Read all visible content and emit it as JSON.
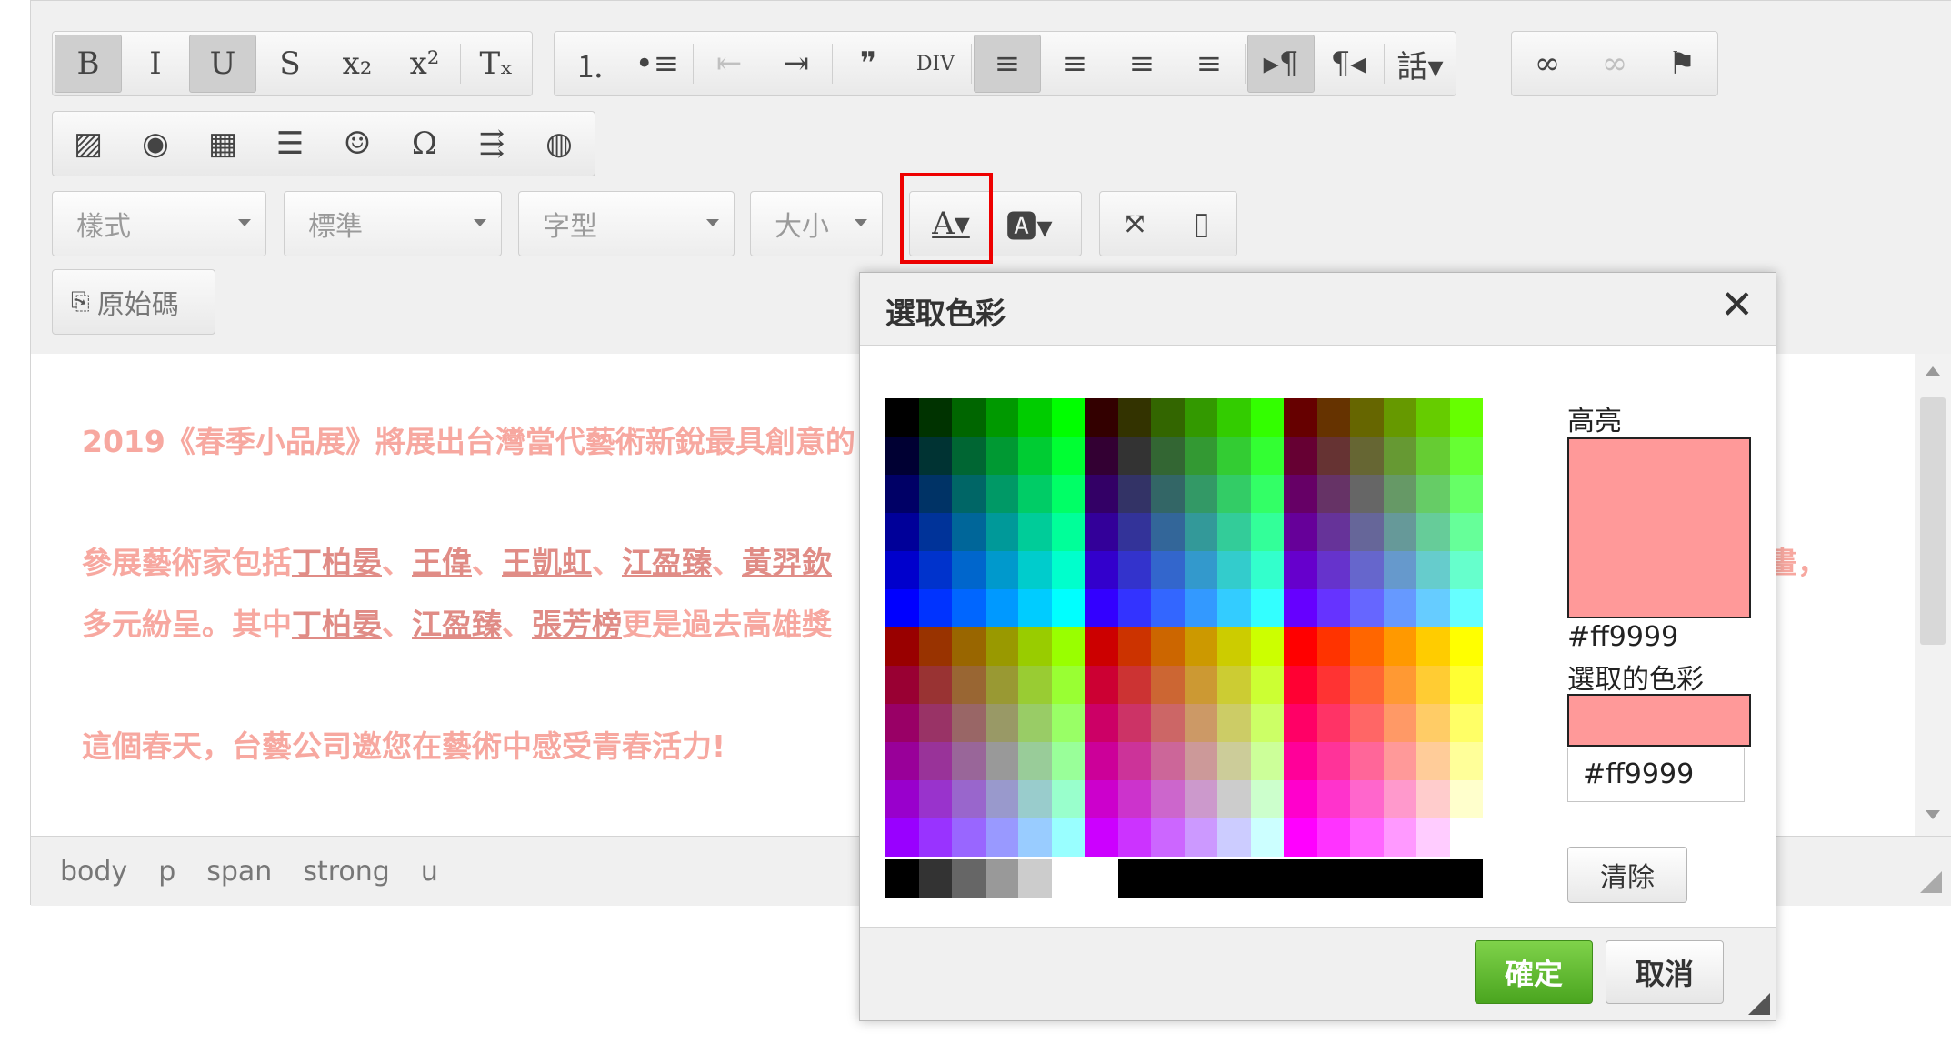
{
  "toolbar": {
    "row1_group1": [
      {
        "name": "bold-button",
        "label": "B",
        "on": true
      },
      {
        "name": "italic-button",
        "label": "I",
        "on": false
      },
      {
        "name": "underline-button",
        "label": "U",
        "on": true
      },
      {
        "name": "strike-button",
        "label": "S",
        "on": false
      },
      {
        "name": "subscript-button",
        "label": "x₂",
        "on": false
      },
      {
        "name": "superscript-button",
        "label": "x²",
        "on": false
      },
      {
        "name": "remove-format-button",
        "label": "Tₓ",
        "on": false
      }
    ],
    "row1_group2": [
      {
        "name": "numbered-list-button",
        "label": "⒈",
        "on": false
      },
      {
        "name": "bulleted-list-button",
        "label": "•≡",
        "on": false
      },
      {
        "name": "outdent-button",
        "label": "⇤",
        "on": false,
        "dis": true
      },
      {
        "name": "indent-button",
        "label": "⇥",
        "on": false
      },
      {
        "name": "blockquote-button",
        "label": "❞",
        "on": false
      },
      {
        "name": "div-button",
        "label": "DIV",
        "on": false
      },
      {
        "name": "align-left-button",
        "label": "≡",
        "on": true
      },
      {
        "name": "align-center-button",
        "label": "≡",
        "on": false
      },
      {
        "name": "align-right-button",
        "label": "≡",
        "on": false
      },
      {
        "name": "justify-button",
        "label": "≡",
        "on": false
      },
      {
        "name": "ltr-button",
        "label": "▸¶",
        "on": true
      },
      {
        "name": "rtl-button",
        "label": "¶◂",
        "on": false
      },
      {
        "name": "language-button",
        "label": "話▾",
        "on": false
      }
    ],
    "row1_group3": [
      {
        "name": "link-button",
        "label": "∞",
        "on": false
      },
      {
        "name": "unlink-button",
        "label": "∞",
        "on": false,
        "dis": true
      },
      {
        "name": "anchor-button",
        "label": "⚑",
        "on": false
      }
    ],
    "row2_group1": [
      {
        "name": "image-button",
        "label": "▨",
        "on": false
      },
      {
        "name": "flash-button",
        "label": "◉",
        "on": false
      },
      {
        "name": "table-button",
        "label": "▦",
        "on": false
      },
      {
        "name": "horizontal-rule-button",
        "label": "☰",
        "on": false
      },
      {
        "name": "smiley-button",
        "label": "☺",
        "on": false
      },
      {
        "name": "special-char-button",
        "label": "Ω",
        "on": false
      },
      {
        "name": "page-break-button",
        "label": "⇶",
        "on": false
      },
      {
        "name": "iframe-button",
        "label": "◍",
        "on": false
      }
    ],
    "combos": {
      "styles": "樣式",
      "format": "標準",
      "font": "字型",
      "size": "大小"
    },
    "text_color_label": "A▾",
    "bg_color_label": "🅰▾",
    "maximize_label": "⤧",
    "show_blocks_label": "▯",
    "source_label": "原始碼"
  },
  "content": {
    "line1": "2019《春季小品展》將展出台灣當代藝術新銳最具創意的",
    "line2_prefix": "參展藝術家包括",
    "line2_names": [
      "丁柏晏",
      "王偉",
      "王凱虹",
      "江盈臻",
      "黃羿欽"
    ],
    "line2_sep": "、",
    "line2_tail": "畫，",
    "line3_prefix": "多元紛呈。其中",
    "line3_names": [
      "丁柏晏",
      "江盈臻",
      "張芳榜"
    ],
    "line3_tail": "更是過去高雄獎",
    "line4": "這個春天，台藝公司邀您在藝術中感受青春活力!"
  },
  "statusbar": [
    "body",
    "p",
    "span",
    "strong",
    "u"
  ],
  "dialog": {
    "title": "選取色彩",
    "close": "✕",
    "highlight_label": "高亮",
    "highlight_hex": "#ff9999",
    "selected_label": "選取的色彩",
    "selected_hex": "#ff9999",
    "input_value": "#ff9999",
    "clear_label": "清除",
    "ok_label": "確定",
    "cancel_label": "取消",
    "highlight_color": "#ff9999"
  }
}
